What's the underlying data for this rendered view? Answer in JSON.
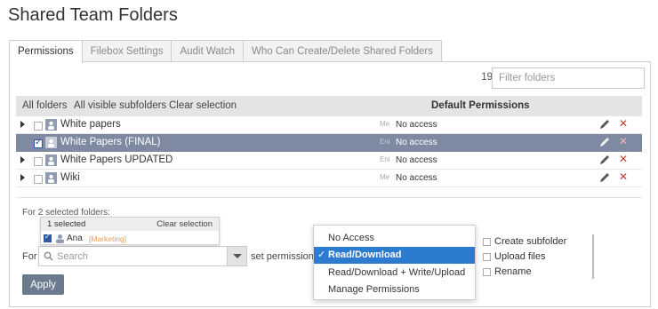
{
  "page": {
    "title": "Shared Team Folders"
  },
  "tabs": [
    {
      "label": "Permissions",
      "active": true
    },
    {
      "label": "Filebox Settings",
      "active": false
    },
    {
      "label": "Audit Watch",
      "active": false
    },
    {
      "label": "Who Can Create/Delete Shared Folders",
      "active": false
    }
  ],
  "filter": {
    "count": "19",
    "placeholder": "Filter folders"
  },
  "table": {
    "header_links": [
      "All folders",
      "All visible subfolders",
      "Clear selection"
    ],
    "permissions_header": "Default Permissions",
    "rows": [
      {
        "name": "White papers",
        "owner_tag": "Me",
        "permission": "No access",
        "checked": false,
        "selected": false
      },
      {
        "name": "White Papers (FINAL)",
        "owner_tag": "Eni",
        "permission": "No access",
        "checked": true,
        "selected": true
      },
      {
        "name": "White Papers UPDATED",
        "owner_tag": "Eni",
        "permission": "No access",
        "checked": false,
        "selected": false
      },
      {
        "name": "Wiki",
        "owner_tag": "Me",
        "permission": "No access",
        "checked": false,
        "selected": false
      }
    ]
  },
  "bottom": {
    "for_selected": "For 2 selected folders:",
    "popup": {
      "selected_count": "1 selected",
      "clear_label": "Clear selection",
      "user_name": "Ana",
      "user_group": "[Marketing]"
    },
    "for_label": "For",
    "search_placeholder": "Search",
    "set_permissions": "set permissions",
    "apply_label": "Apply"
  },
  "permission_menu": {
    "options": [
      "No Access",
      "Read/Download",
      "Read/Download + Write/Upload",
      "Manage Permissions"
    ],
    "selected": "Read/Download"
  },
  "extra_options": [
    "Create subfolder",
    "Upload files",
    "Rename"
  ],
  "colors": {
    "selected_row": "#7d8aa1",
    "menu_highlight": "#2d7bd1",
    "delete_icon": "#c0392b",
    "apply_button": "#6b7a8f"
  }
}
